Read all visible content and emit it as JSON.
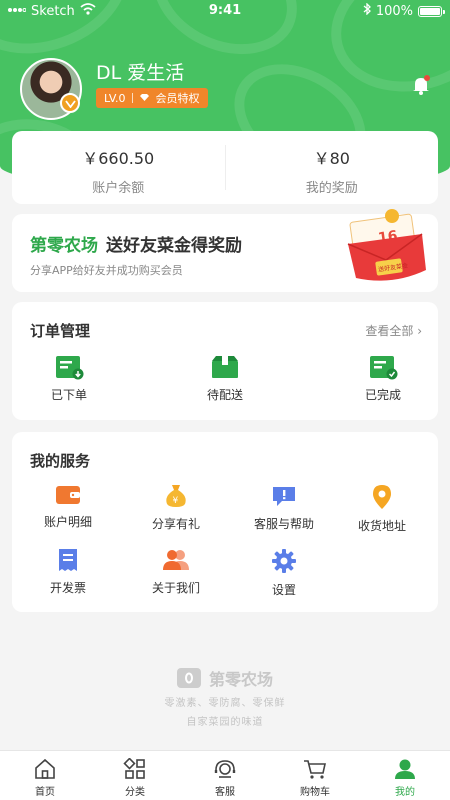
{
  "status_bar": {
    "carrier": "Sketch",
    "time": "9:41",
    "battery": "100%"
  },
  "profile": {
    "username": "DL 爱生活",
    "level": "LV.0",
    "member_privilege": "会员特权"
  },
  "balance": {
    "account_value": "￥660.50",
    "account_label": "账户余额",
    "reward_value": "￥80",
    "reward_label": "我的奖励"
  },
  "promo": {
    "brand": "第零农场",
    "title": "送好友菜金得奖励",
    "subtitle": "分享APP给好友并成功购买会员",
    "ticket_amount": "16",
    "ticket_text": "送好友菜金"
  },
  "orders": {
    "title": "订单管理",
    "see_all": "查看全部 ›",
    "items": [
      {
        "label": "已下单",
        "icon": "order-placed-icon"
      },
      {
        "label": "待配送",
        "icon": "pending-delivery-icon"
      },
      {
        "label": "已完成",
        "icon": "order-completed-icon"
      }
    ]
  },
  "services": {
    "title": "我的服务",
    "items": [
      {
        "label": "账户明细",
        "icon": "wallet-icon"
      },
      {
        "label": "分享有礼",
        "icon": "money-bag-icon"
      },
      {
        "label": "客服与帮助",
        "icon": "help-message-icon"
      },
      {
        "label": "收货地址",
        "icon": "location-pin-icon"
      },
      {
        "label": "开发票",
        "icon": "invoice-icon"
      },
      {
        "label": "关于我们",
        "icon": "users-icon"
      },
      {
        "label": "设置",
        "icon": "gear-icon"
      }
    ]
  },
  "brand": {
    "name": "第零农场",
    "slogan_1": "零激素、零防腐、零保鲜",
    "slogan_2": "自家菜园的味道"
  },
  "tabbar": {
    "items": [
      {
        "label": "首页",
        "icon": "home-icon"
      },
      {
        "label": "分类",
        "icon": "category-icon"
      },
      {
        "label": "客服",
        "icon": "customer-service-icon"
      },
      {
        "label": "购物车",
        "icon": "cart-icon"
      },
      {
        "label": "我的",
        "icon": "profile-icon",
        "active": true
      }
    ]
  },
  "colors": {
    "brand_green": "#47c262",
    "accent_orange": "#f0862a",
    "text_dark": "#333333"
  }
}
